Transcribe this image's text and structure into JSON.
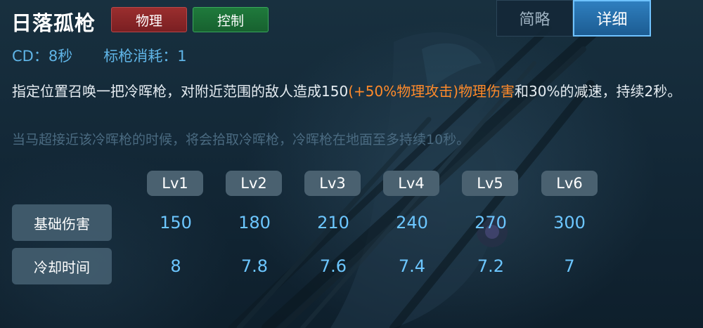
{
  "skill": {
    "name": "日落孤枪",
    "tags": [
      "物理",
      "控制"
    ],
    "cd_text": "CD：8秒",
    "cost_text": "标枪消耗：1"
  },
  "view_toggle": {
    "brief_label": "简略",
    "detail_label": "详细",
    "selected": "详细"
  },
  "description": {
    "part1": "指定位置召唤一把冷晖枪，对附近范围的敌人造成150",
    "highlight": "(+50%物理攻击)物理伤害",
    "part2": "和30%的减速，持续2秒。",
    "note": "当马超接近该冷晖枪的时候，将会拾取冷晖枪，冷晖枪在地面至多持续10秒。"
  },
  "table": {
    "levels": [
      "Lv1",
      "Lv2",
      "Lv3",
      "Lv4",
      "Lv5",
      "Lv6"
    ],
    "rows": [
      {
        "label": "基础伤害",
        "values": [
          "150",
          "180",
          "210",
          "240",
          "270",
          "300"
        ]
      },
      {
        "label": "冷却时间",
        "values": [
          "8",
          "7.8",
          "7.6",
          "7.4",
          "7.2",
          "7"
        ]
      }
    ]
  },
  "colors": {
    "accent_blue": "#5fb4e6",
    "value_blue": "#6cc6ff",
    "highlight_orange": "#ff8a2a",
    "physical_red": "#9a2e2e",
    "control_green": "#1f7a3c",
    "note_gray": "#4a6a80"
  }
}
